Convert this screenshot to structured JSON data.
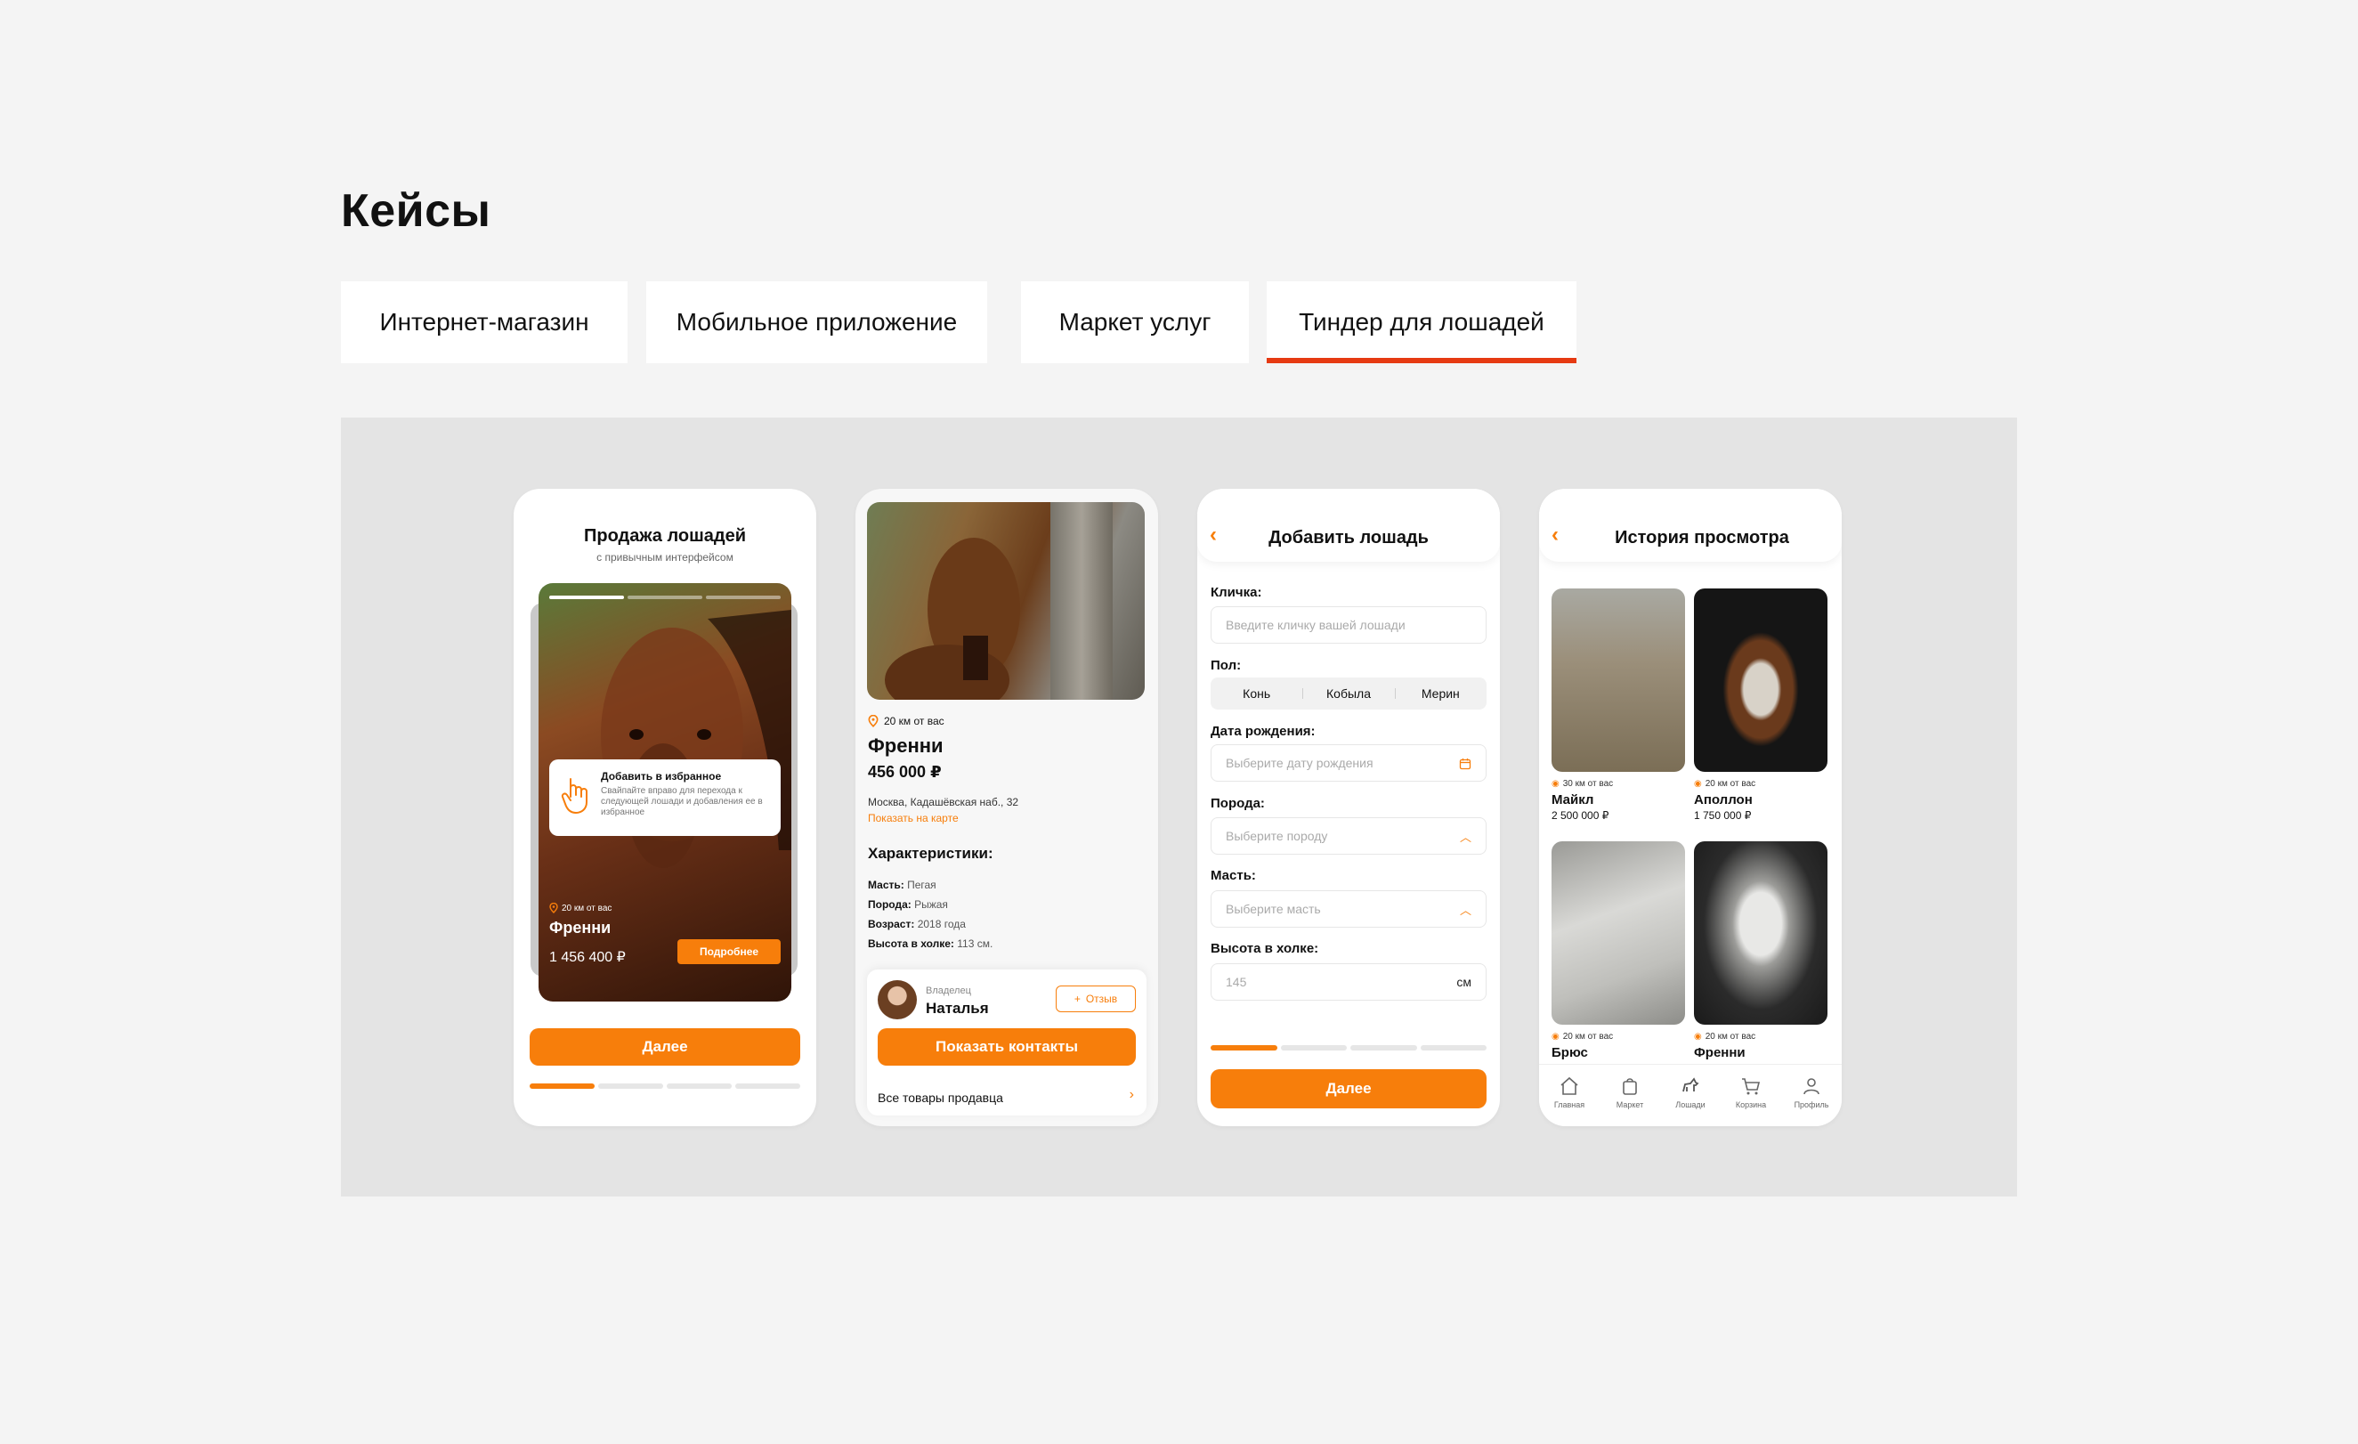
{
  "page": {
    "title": "Кейсы"
  },
  "tabs": [
    {
      "label": "Интернет-магазин"
    },
    {
      "label": "Мобильное приложение"
    },
    {
      "label": "Маркет услуг"
    },
    {
      "label": "Тиндер для лошадей"
    }
  ],
  "accent_color": "#f77e0b",
  "tab_underline_color": "#e63a12",
  "phone1": {
    "title": "Продажа лошадей",
    "subtitle": "с привычным интерфейсом",
    "tip_title": "Добавить в избранное",
    "tip_text": "Свайпайте вправо для перехода к следующей лошади и добавления ее в избранное",
    "distance": "20 км от вас",
    "name": "Френни",
    "price": "1 456 400 ₽",
    "more_label": "Подробнее",
    "next_label": "Далее",
    "progress_step": 1,
    "progress_total": 4
  },
  "phone2": {
    "distance": "20 км от вас",
    "name": "Френни",
    "price": "456 000 ₽",
    "address": "Москва, Кадашёвская наб., 32",
    "map_link": "Показать на карте",
    "chars_title": "Характеристики:",
    "chars": [
      {
        "k": "Масть:",
        "v": "Пегая"
      },
      {
        "k": "Порода:",
        "v": "Рыжая"
      },
      {
        "k": "Возраст:",
        "v": "2018 года"
      },
      {
        "k": "Высота в холке:",
        "v": "113 см."
      }
    ],
    "owner_label": "Владелец",
    "owner_name": "Наталья",
    "review_label": "Отзыв",
    "contacts_label": "Показать контакты",
    "all_items_label": "Все товары продавца"
  },
  "phone3": {
    "title": "Добавить лошадь",
    "name_label": "Кличка:",
    "name_placeholder": "Введите кличку вашей лошади",
    "sex_label": "Пол:",
    "sex_options": [
      "Конь",
      "Кобыла",
      "Мерин"
    ],
    "birth_label": "Дата рождения:",
    "birth_placeholder": "Выберите дату рождения",
    "breed_label": "Порода:",
    "breed_placeholder": "Выберите породу",
    "color_label": "Масть:",
    "color_placeholder": "Выберите масть",
    "height_label": "Высота в холке:",
    "height_value": "145",
    "height_unit": "см",
    "next_label": "Далее",
    "progress_step": 1,
    "progress_total": 4
  },
  "phone4": {
    "title": "История просмотра",
    "items": [
      {
        "distance": "30 км от вас",
        "name": "Майкл",
        "price": "2 500 000 ₽"
      },
      {
        "distance": "20 км от вас",
        "name": "Аполлон",
        "price": "1 750 000 ₽"
      },
      {
        "distance": "20 км от вас",
        "name": "Брюс",
        "price": ""
      },
      {
        "distance": "20 км от вас",
        "name": "Френни",
        "price": ""
      }
    ],
    "nav": [
      {
        "label": "Главная",
        "icon": "home-icon"
      },
      {
        "label": "Маркет",
        "icon": "bag-icon"
      },
      {
        "label": "Лошади",
        "icon": "horse-icon"
      },
      {
        "label": "Корзина",
        "icon": "cart-icon"
      },
      {
        "label": "Профиль",
        "icon": "profile-icon"
      }
    ]
  }
}
